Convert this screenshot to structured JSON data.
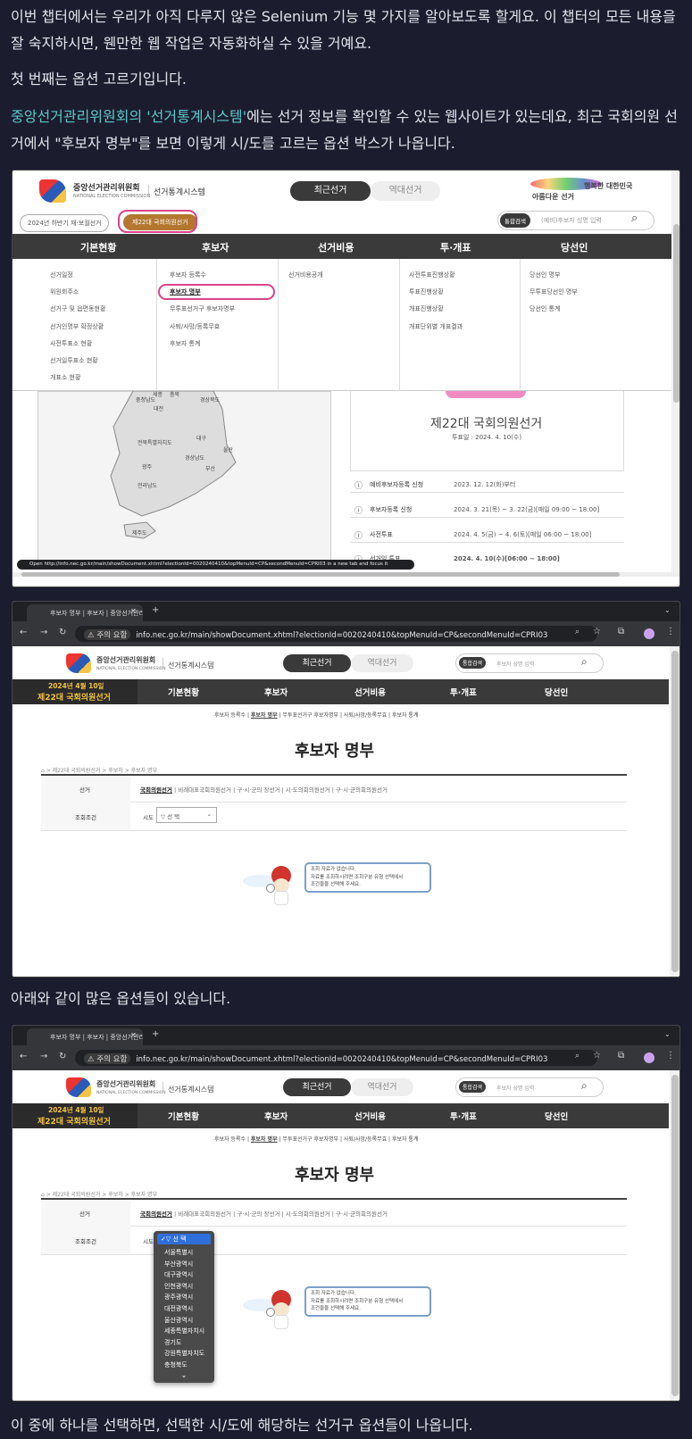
{
  "paragraphs": {
    "p1": "이번 챕터에서는 우리가 아직 다루지 않은 Selenium 기능 몇 가지를 알아보도록 할게요. 이 챕터의 모든 내용을 잘 숙지하시면, 웬만한 웹 작업은 자동화하실 수 있을 거예요.",
    "p2": "첫 번째는 옵션 고르기입니다.",
    "p3_link": "중앙선거관리위원회의 '선거통계시스템'",
    "p3_rest": "에는 선거 정보를 확인할 수 있는 웹사이트가 있는데요, 최근 국회의원 선거에서 \"후보자 명부\"를 보면 이렇게 시/도를 고르는 옵션 박스가 나옵니다.",
    "p4": "아래와 같이 많은 옵션들이 있습니다.",
    "p5": "이 중에 하나를 선택하면, 선택한 시/도에 해당하는 선거구 옵션들이 나옵니다."
  },
  "site": {
    "org_name": "중앙선거관리위원회",
    "org_sub": "NATIONAL ELECTION COMMISSION",
    "system_name": "선거통계시스템",
    "tab_recent": "최근선거",
    "tab_past": "역대선거",
    "slogan_left": "아름다운 선거",
    "slogan_right": "행복한 대한민국",
    "search_btn": "통합검색",
    "search_placeholder1": "(예비)후보자 성명 입력",
    "search_placeholder2": "후보자 성명 입력",
    "election_chip1": "2024년 하반기 재·보궐선거",
    "election_chip2": "제22대 국회의원선거",
    "badge_date": "2024년 4월 10일",
    "badge_name": "제22대 국회의원선거"
  },
  "menu": {
    "top": [
      "기본현황",
      "후보자",
      "선거비용",
      "투·개표",
      "당선인"
    ],
    "col1": [
      "선거일정",
      "위원회주소",
      "선거구 및 읍면동현황",
      "선거인명부 확정상황",
      "사전투표소 현황",
      "선거일투표소 현황",
      "개표소 현황"
    ],
    "col2": [
      "후보자 등록수",
      "후보자 명부",
      "무투표선거구 후보자명부",
      "사퇴/사망/등록무효",
      "후보자 통계"
    ],
    "col3": [
      "선거비용공개"
    ],
    "col4": [
      "사전투표진행상황",
      "투표진행상황",
      "개표진행상황",
      "개표단위별 개표결과"
    ],
    "col5": [
      "당선인 명부",
      "무투표당선인 명부",
      "당선인 통계"
    ]
  },
  "map_regions": [
    "충청남도",
    "세종",
    "대전",
    "충북",
    "경상북도",
    "전북특별자치도",
    "대구",
    "경상남도",
    "울산",
    "광주",
    "전라남도",
    "부산",
    "제주도"
  ],
  "election_info": {
    "title": "제22대 국회의원선거",
    "vote_date": "투표일 : 2024. 4. 10(수)",
    "rows": [
      {
        "label": "예비후보자등록 신청",
        "value": "2023. 12. 12(화)부터"
      },
      {
        "label": "후보자등록 신청",
        "value": "2024. 3. 21(목) ~ 3. 22(금)[매일 09:00 ~ 18:00]"
      },
      {
        "label": "사전투표",
        "value": "2024. 4. 5(금) ~ 4. 6(토)[매일 06:00 ~ 18:00]"
      },
      {
        "label": "선거일 투표",
        "value": "2024. 4. 10(수)[06:00 ~ 18:00]"
      }
    ]
  },
  "status_url": "Open http://info.nec.go.kr/main/showDocument.xhtml?electionId=0020240410&topMenuId=CP&secondMenuId=CPRI03 in a new tab and focus it",
  "browser": {
    "tab_title": "후보자 명부 | 후보자 | 중앙선거관리",
    "warning": "주의 요함",
    "url": "info.nec.go.kr/main/showDocument.xhtml?electionId=0020240410&topMenuId=CP&secondMenuId=CPRI03"
  },
  "page": {
    "subnav": [
      "후보자 등록수",
      "후보자 명부",
      "무투표선거구 후보자명부",
      "사퇴/사망/등록무효",
      "후보자 통계"
    ],
    "title": "후보자 명부",
    "breadcrumb": "> 제22대 국회의원선거 > 후보자 > 후보자 명부",
    "row1_label": "선거",
    "row1_options": [
      "국회의원선거",
      "비례대표국회의원선거",
      "구·시·군의 장선거",
      "시·도의회의원선거",
      "구·시·군의회의원선거"
    ],
    "row2_label": "조회조건",
    "sido_label": "시도",
    "sido_value": "▽ 선 택",
    "notice1": "조회 자료가 없습니다.",
    "notice2": "자료를 조회하시려면 조회구분 유형 선택에서",
    "notice3": "조건들을 선택해 주세요."
  },
  "dropdown": {
    "selected": "✓▽ 선 택",
    "options": [
      "서울특별시",
      "부산광역시",
      "대구광역시",
      "인천광역시",
      "광주광역시",
      "대전광역시",
      "울산광역시",
      "세종특별자치시",
      "경기도",
      "강원특별자치도",
      "충청북도"
    ],
    "more": "⌄"
  },
  "colors": {
    "accent_link": "#5cc7c9",
    "highlight": "#d9438a",
    "badge": "#f5c342",
    "nav": "#3a3a3a"
  }
}
